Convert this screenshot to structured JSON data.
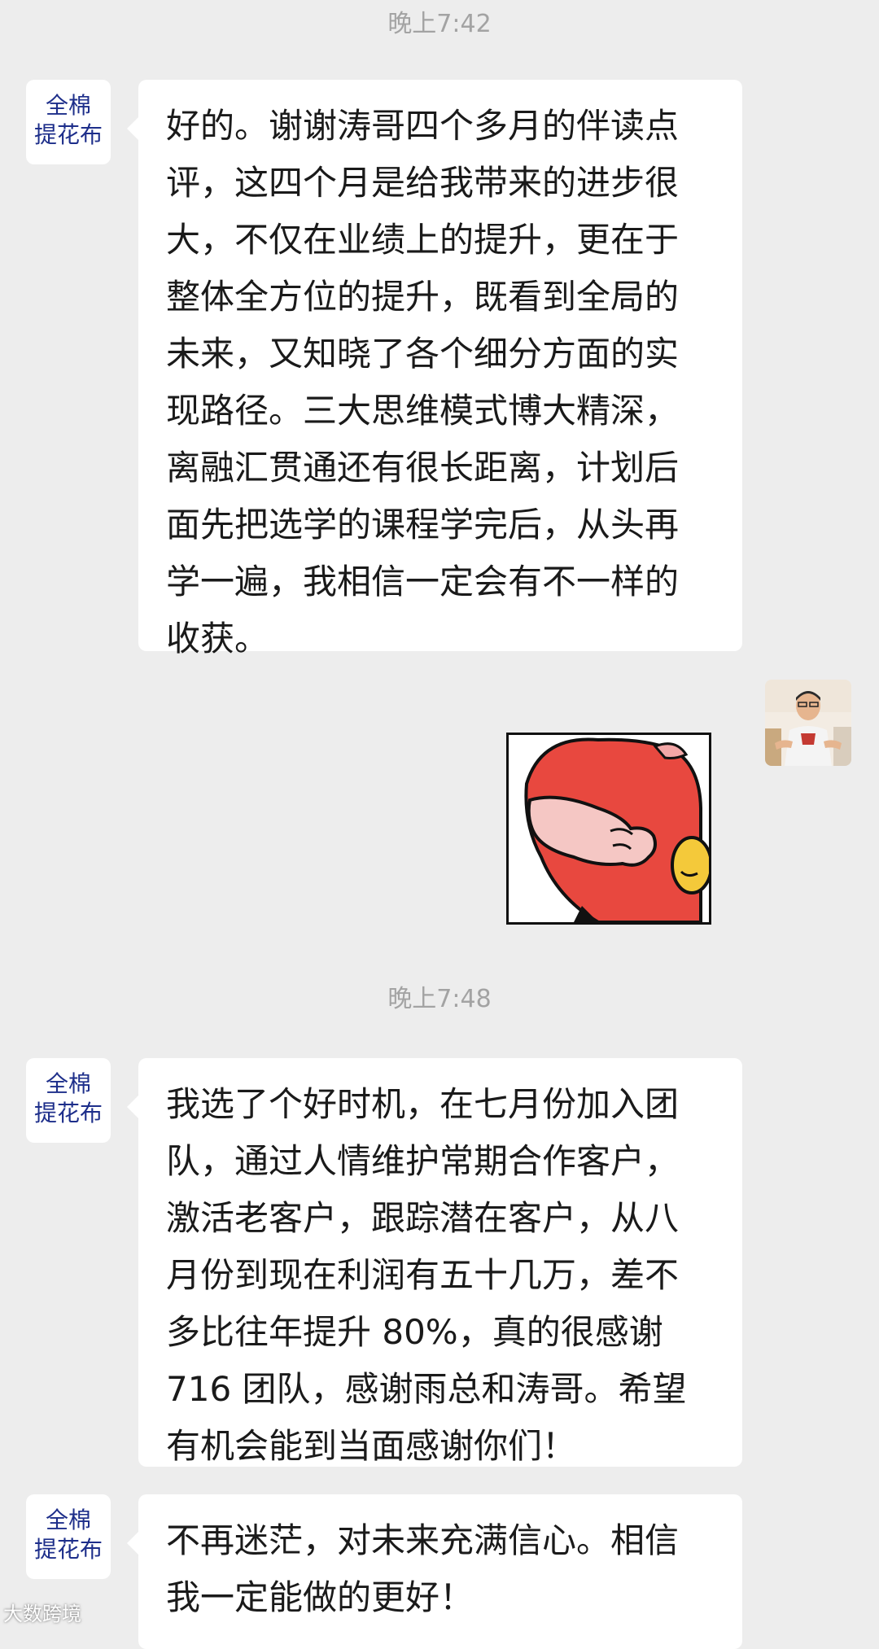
{
  "chat": {
    "timestamps": [
      "晚上7:42",
      "晚上7:48"
    ],
    "contact": {
      "avatar_line1": "全棉",
      "avatar_line2": "提花布"
    },
    "messages": [
      {
        "lines": [
          "好的。谢谢涛哥四个多月的伴读点",
          "评，这四个月是给我带来的进步很",
          "大，不仅在业绩上的提升，更在于",
          "整体全方位的提升，既看到全局的",
          "未来，又知晓了各个细分方面的实",
          "现路径。三大思维模式博大精深，",
          "离融汇贯通还有很长距离，计划后",
          "面先把选学的课程学完后，从头再",
          "学一遍，我相信一定会有不一样的",
          "收获。"
        ]
      },
      {
        "lines": [
          "我选了个好时机，在七月份加入团",
          "队，通过人情维护常期合作客户，",
          "激活老客户，跟踪潜在客户，从八",
          "月份到现在利润有五十几万，差不",
          "多比往年提升 80%，真的很感谢",
          "716 团队，感谢雨总和涛哥。希望",
          "有机会能到当面感谢你们！"
        ]
      },
      {
        "lines": [
          "不再迷茫，对未来充满信心。相信",
          "我一定能做的更好！"
        ]
      }
    ]
  },
  "watermark": "大数跨境",
  "colors": {
    "background": "#ededed",
    "bubble": "#ffffff",
    "sticker_red": "#e8483f",
    "sticker_yellow": "#f4c93a"
  }
}
